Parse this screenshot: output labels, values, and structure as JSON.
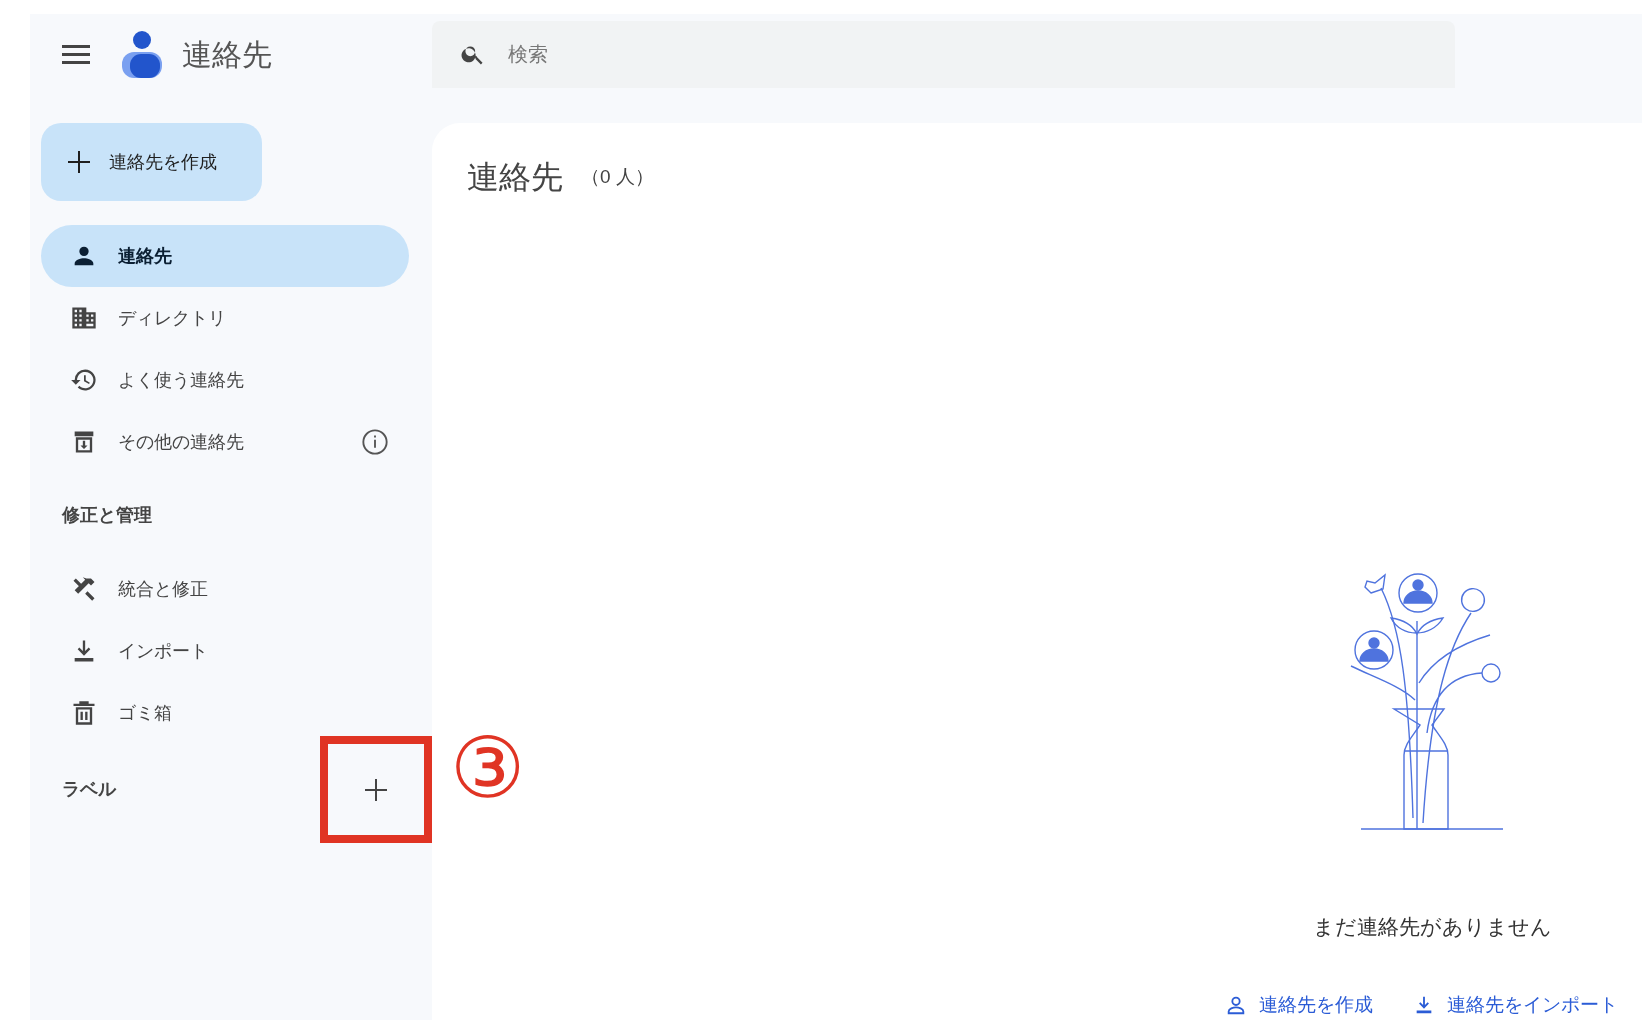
{
  "header": {
    "app_title": "連絡先",
    "search": {
      "placeholder": "検索"
    }
  },
  "sidebar": {
    "create_button": "連絡先を作成",
    "items": [
      {
        "label": "連絡先",
        "selected": true
      },
      {
        "label": "ディレクトリ",
        "selected": false
      },
      {
        "label": "よく使う連絡先",
        "selected": false
      },
      {
        "label": "その他の連絡先",
        "selected": false
      }
    ],
    "fix_section": {
      "title": "修正と管理",
      "items": [
        {
          "label": "統合と修正"
        },
        {
          "label": "インポート"
        },
        {
          "label": "ゴミ箱"
        }
      ]
    },
    "labels_section": {
      "title": "ラベル"
    }
  },
  "annotation": {
    "number": "③"
  },
  "main": {
    "title": "連絡先",
    "count": "（0 人）",
    "empty_message": "まだ連絡先がありません",
    "actions": [
      "連絡先を作成",
      "連絡先をインポート"
    ]
  }
}
